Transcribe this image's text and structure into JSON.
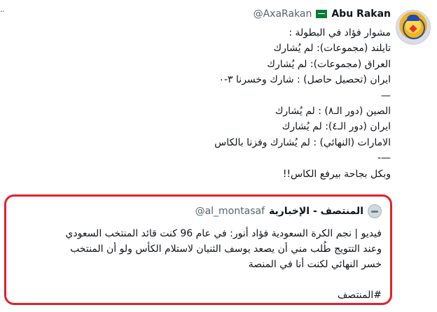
{
  "tweet": {
    "truncated_mark": "..",
    "author_name": "Abu Rakan",
    "verified_badge": "saudi-flag-icon",
    "author_handle": "@AxaRakan",
    "lines": [
      "مشوار فؤاد في البطولة :",
      "تايلند (مجموعات): لم يُشارك",
      "العراق (مجموعات): لم يُشارك",
      "ايران (تحصيل حاصل) : شارك وخسرنا ٣-٠",
      "—",
      "الصين (دور الـ٨) : لم يُشارك",
      "ايران (دور الـ٤): لم يُشارك",
      "الامارات (النهائي) : لم يُشارك وفزنا بالكاس",
      "—-",
      "وبكل بجاحة بيرفع الكاس!!"
    ]
  },
  "quote": {
    "author_name": "المنتصف - الإخبارية",
    "author_handle": "@al_montasaf",
    "lines": [
      "فيديو | نجم الكرة السعودية فؤاد أنور: في عام 96 كنت قائد المنتخب السعودي",
      "وعند التتويج طُلب مني أن يصعد يوسف الثنيان لاستلام الكأس ولو أن المنتخب",
      "خسر النهائي لكنت أنا في المنصة",
      "",
      "#المنتصف"
    ],
    "highlight_color": "#e3212a"
  }
}
